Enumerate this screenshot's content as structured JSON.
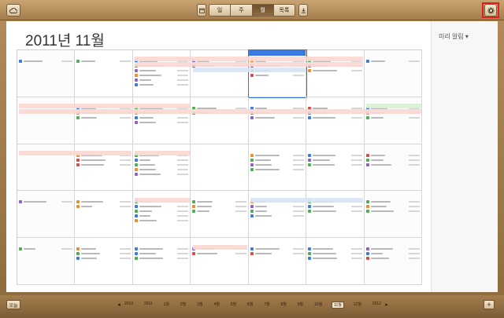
{
  "toolbar": {
    "views": [
      "일",
      "주",
      "월",
      "목록"
    ],
    "active_view": "월",
    "cloud_icon": "cloud-icon",
    "calendars_icon": "calendars-icon",
    "download_icon": "download-icon",
    "gear_icon": "gear-icon"
  },
  "header": {
    "month_title": "2011년 11월",
    "reminders_label": "미리 알림 ▾"
  },
  "calendar": {
    "today_label": "오늘",
    "colors": {
      "green": "#4caf50",
      "orange": "#f08a2a",
      "blue": "#3a7be0",
      "purple": "#8c62c8",
      "red": "#e04848",
      "pink_span": "#f9d7d0",
      "blue_span": "#d7e4f7",
      "green_span": "#d8f0d2"
    }
  },
  "bottombar": {
    "today_button": "오늘",
    "timeline": [
      "2010",
      "2011",
      "1월",
      "2월",
      "3월",
      "4월",
      "5월",
      "6월",
      "7월",
      "8월",
      "9월",
      "10월",
      "11월",
      "12월",
      "2012"
    ],
    "selected": "11월",
    "add_button": "+"
  }
}
